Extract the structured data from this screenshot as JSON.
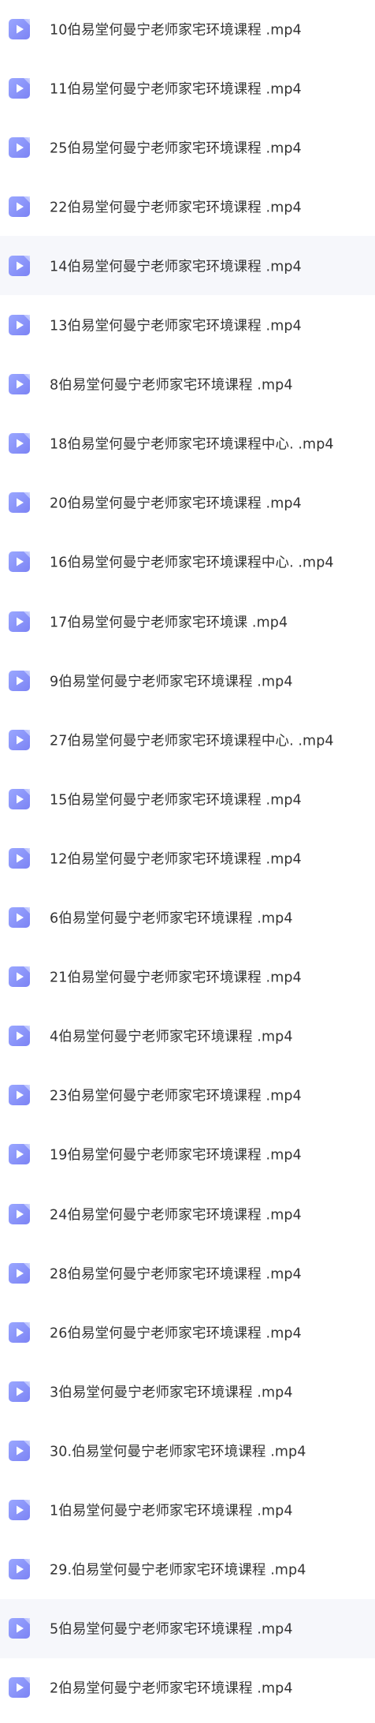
{
  "colors": {
    "row_alt_background": "#f6f7fb",
    "icon_gradient_start": "#9aa7ff",
    "icon_gradient_end": "#7c83f4",
    "text": "#333333"
  },
  "file_icon_name": "video-file-icon",
  "files": [
    {
      "name": "10伯易堂何曼宁老师家宅环境课程 .mp4",
      "alt": false
    },
    {
      "name": "11伯易堂何曼宁老师家宅环境课程 .mp4",
      "alt": false
    },
    {
      "name": "25伯易堂何曼宁老师家宅环境课程 .mp4",
      "alt": false
    },
    {
      "name": "22伯易堂何曼宁老师家宅环境课程 .mp4",
      "alt": false
    },
    {
      "name": "14伯易堂何曼宁老师家宅环境课程 .mp4",
      "alt": true
    },
    {
      "name": "13伯易堂何曼宁老师家宅环境课程 .mp4",
      "alt": false
    },
    {
      "name": "8伯易堂何曼宁老师家宅环境课程 .mp4",
      "alt": false
    },
    {
      "name": "18伯易堂何曼宁老师家宅环境课程中心. .mp4",
      "alt": false
    },
    {
      "name": "20伯易堂何曼宁老师家宅环境课程 .mp4",
      "alt": false
    },
    {
      "name": "16伯易堂何曼宁老师家宅环境课程中心. .mp4",
      "alt": false
    },
    {
      "name": "17伯易堂何曼宁老师家宅环境课 .mp4",
      "alt": false
    },
    {
      "name": "9伯易堂何曼宁老师家宅环境课程 .mp4",
      "alt": false
    },
    {
      "name": "27伯易堂何曼宁老师家宅环境课程中心. .mp4",
      "alt": false
    },
    {
      "name": "15伯易堂何曼宁老师家宅环境课程 .mp4",
      "alt": false
    },
    {
      "name": "12伯易堂何曼宁老师家宅环境课程 .mp4",
      "alt": false
    },
    {
      "name": "6伯易堂何曼宁老师家宅环境课程 .mp4",
      "alt": false
    },
    {
      "name": "21伯易堂何曼宁老师家宅环境课程 .mp4",
      "alt": false
    },
    {
      "name": "4伯易堂何曼宁老师家宅环境课程 .mp4",
      "alt": false
    },
    {
      "name": "23伯易堂何曼宁老师家宅环境课程 .mp4",
      "alt": false
    },
    {
      "name": "19伯易堂何曼宁老师家宅环境课程 .mp4",
      "alt": false
    },
    {
      "name": "24伯易堂何曼宁老师家宅环境课程 .mp4",
      "alt": false
    },
    {
      "name": "28伯易堂何曼宁老师家宅环境课程 .mp4",
      "alt": false
    },
    {
      "name": "26伯易堂何曼宁老师家宅环境课程 .mp4",
      "alt": false
    },
    {
      "name": "3伯易堂何曼宁老师家宅环境课程 .mp4",
      "alt": false
    },
    {
      "name": "30.伯易堂何曼宁老师家宅环境课程 .mp4",
      "alt": false
    },
    {
      "name": "1伯易堂何曼宁老师家宅环境课程 .mp4",
      "alt": false
    },
    {
      "name": "29.伯易堂何曼宁老师家宅环境课程 .mp4",
      "alt": false
    },
    {
      "name": "5伯易堂何曼宁老师家宅环境课程 .mp4",
      "alt": true
    },
    {
      "name": "2伯易堂何曼宁老师家宅环境课程 .mp4",
      "alt": false
    }
  ]
}
